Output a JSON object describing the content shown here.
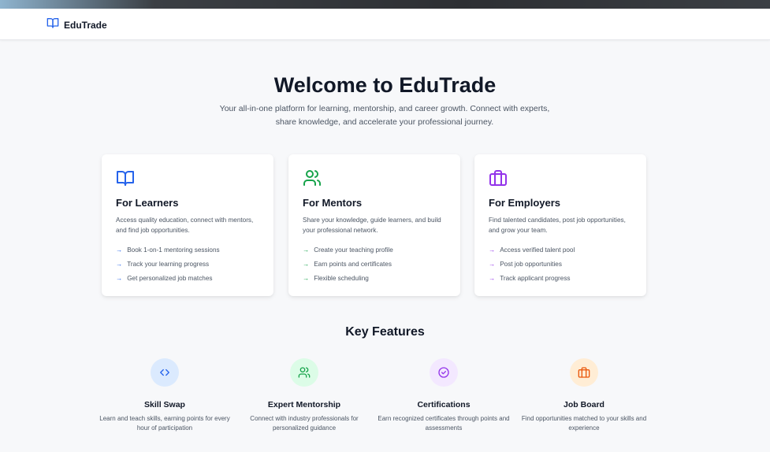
{
  "brand": {
    "name": "EduTrade",
    "icon": "book-open-icon"
  },
  "hero": {
    "title": "Welcome to EduTrade",
    "subtitle": "Your all-in-one platform for learning, mentorship, and career growth. Connect with experts, share knowledge, and accelerate your professional journey."
  },
  "cards": [
    {
      "title": "For Learners",
      "icon": "book-open-icon",
      "accent": "#2563eb",
      "description": "Access quality education, connect with mentors, and find job opportunities.",
      "items": [
        "Book 1-on-1 mentoring sessions",
        "Track your learning progress",
        "Get personalized job matches"
      ]
    },
    {
      "title": "For Mentors",
      "icon": "users-icon",
      "accent": "#16a34a",
      "description": "Share your knowledge, guide learners, and build your professional network.",
      "items": [
        "Create your teaching profile",
        "Earn points and certificates",
        "Flexible scheduling"
      ]
    },
    {
      "title": "For Employers",
      "icon": "briefcase-icon",
      "accent": "#9333ea",
      "description": "Find talented candidates, post job opportunities, and grow your team.",
      "items": [
        "Access verified talent pool",
        "Post job opportunities",
        "Track applicant progress"
      ]
    }
  ],
  "key_features": {
    "title": "Key Features",
    "items": [
      {
        "title": "Skill Swap",
        "icon": "code-icon",
        "color": "#2563eb",
        "bg": "#dbeafe",
        "description": "Learn and teach skills, earning points for every hour of participation"
      },
      {
        "title": "Expert Mentorship",
        "icon": "users-icon",
        "color": "#16a34a",
        "bg": "#dcfce7",
        "description": "Connect with industry professionals for personalized guidance"
      },
      {
        "title": "Certifications",
        "icon": "badge-check-icon",
        "color": "#9333ea",
        "bg": "#f3e8ff",
        "description": "Earn recognized certificates through points and assessments"
      },
      {
        "title": "Job Board",
        "icon": "briefcase-icon",
        "color": "#ea580c",
        "bg": "#ffedd5",
        "description": "Find opportunities matched to your skills and experience"
      }
    ]
  },
  "arrow_glyph": "→"
}
